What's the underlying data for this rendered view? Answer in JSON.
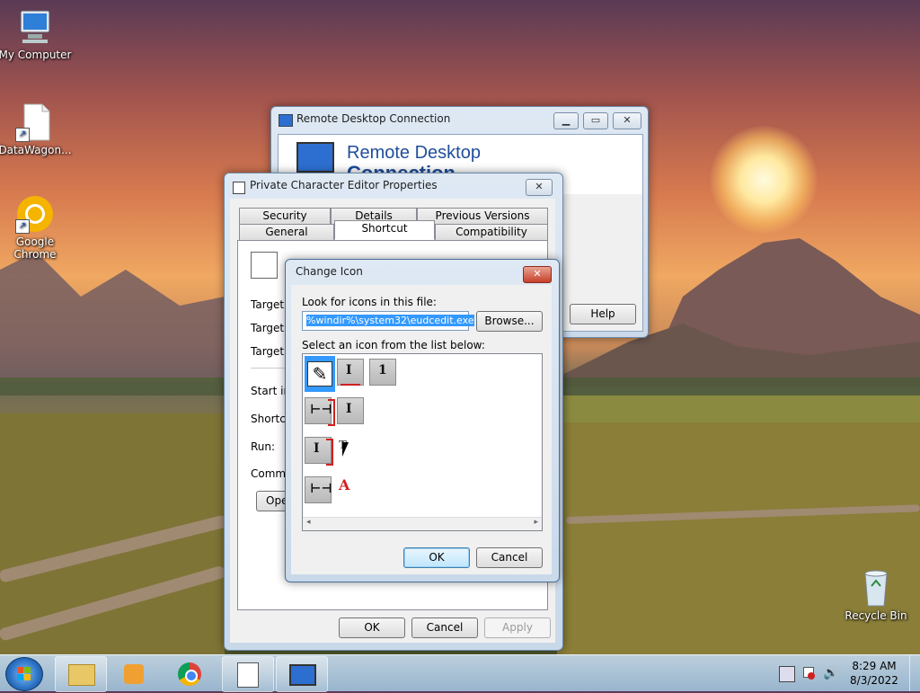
{
  "desktop": {
    "icons": [
      {
        "label": "My Computer"
      },
      {
        "label": "DataWagon..."
      },
      {
        "label": "Google Chrome"
      },
      {
        "label": "Recycle Bin"
      }
    ]
  },
  "rdc_window": {
    "title": "Remote Desktop Connection",
    "banner_line1": "Remote Desktop",
    "banner_line2": "Connection",
    "help_label": "Help"
  },
  "props_window": {
    "title": "Private Character Editor Properties",
    "tabs_row1": [
      "Security",
      "Details",
      "Previous Versions"
    ],
    "tabs_row2": [
      "General",
      "Shortcut",
      "Compatibility"
    ],
    "active_tab": "Shortcut",
    "fields": [
      "Target ty",
      "Target lo",
      "Target:",
      "Start in:",
      "Shortcut",
      "Run:",
      "Commen"
    ],
    "open_button_partial": "Ope",
    "ok_label": "OK",
    "cancel_label": "Cancel",
    "apply_label": "Apply"
  },
  "change_icon": {
    "title": "Change Icon",
    "look_label": "Look for icons in this file:",
    "file_value": "%windir%\\system32\\eudcedit.exe",
    "browse_label": "Browse...",
    "select_label": "Select an icon from the list below:",
    "ok_label": "OK",
    "cancel_label": "Cancel"
  },
  "taskbar": {
    "clock_time": "8:29 AM",
    "clock_date": "8/3/2022"
  },
  "colors": {
    "selection": "#3399ff",
    "banner_text": "#1f4e9a",
    "glyph_red": "#d02020"
  }
}
